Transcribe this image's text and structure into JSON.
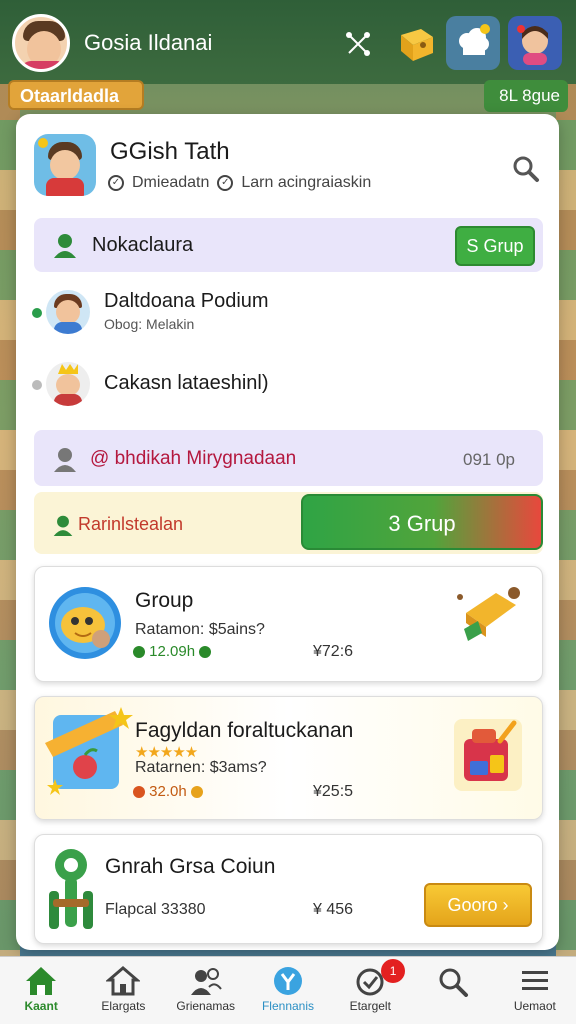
{
  "header": {
    "title": "Gosia Ildanai",
    "left_pill": "Otaarldadla",
    "right_pill": "8L 8gue"
  },
  "group": {
    "title": "GGish Tath",
    "meta_1": "Dmieadatn",
    "meta_2": "Larn acingraiaskin"
  },
  "join_row": {
    "label": "Nokaclaura",
    "button": "S Grup"
  },
  "members": [
    {
      "name": "Daltdoana Podium",
      "sub": "Obog: Melakin",
      "status_color": "#2a9d4b"
    },
    {
      "name": "Cakasn lataeshinl)",
      "sub": "",
      "status_color": "#bbbbbb"
    }
  ],
  "notice_row": {
    "label": "@ bhdikah Mirygnadaan",
    "count": "091 0p"
  },
  "action_row": {
    "label": "Rarinlstealan",
    "button": "3 Grup"
  },
  "cards": [
    {
      "title": "Group",
      "sub": "Ratamon: $5ains?",
      "stat": "12.09h",
      "price": "¥72:6"
    },
    {
      "title": "Fagyldan foraltuckanan",
      "stars": "★★★★★",
      "sub": "Ratarnen: $3ams?",
      "stat": "32.0h",
      "price": "¥25:5"
    },
    {
      "title": "Gnrah Grsa Coiun",
      "sub": "Flapcal 33380",
      "price": "¥ 456",
      "button": "Gooro ›"
    }
  ],
  "nav": [
    {
      "label": "Kaant"
    },
    {
      "label": "Elargats"
    },
    {
      "label": "Grienamas"
    },
    {
      "label": "Flennanis"
    },
    {
      "label": "Etargelt"
    },
    {
      "label": ""
    },
    {
      "label": "Uemaot"
    }
  ],
  "nav_badge": "1"
}
